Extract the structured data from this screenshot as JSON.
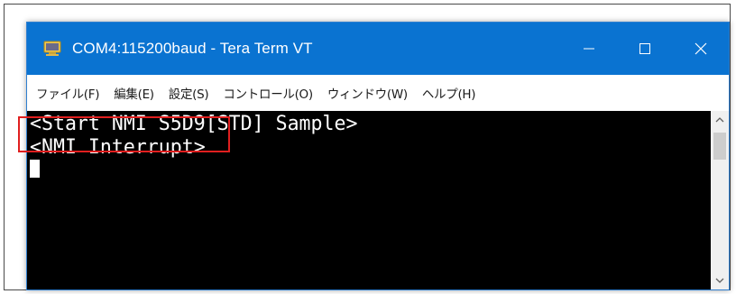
{
  "window": {
    "title": "COM4:115200baud - Tera Term VT",
    "titlebar_color": "#0a73d1",
    "icons": {
      "app": "tera-term-app-icon",
      "minimize": "minimize-icon",
      "maximize": "maximize-icon",
      "close": "close-icon"
    }
  },
  "menu": {
    "items": [
      {
        "label": "ファイル(F)"
      },
      {
        "label": "編集(E)"
      },
      {
        "label": "設定(S)"
      },
      {
        "label": "コントロール(O)"
      },
      {
        "label": "ウィンドウ(W)"
      },
      {
        "label": "ヘルプ(H)"
      }
    ]
  },
  "terminal": {
    "background": "#000000",
    "foreground": "#ffffff",
    "lines": [
      "<Start NMI S5D9[STD] Sample>",
      "<NMI Interrupt>"
    ]
  },
  "annotation": {
    "highlight_color": "#e01f1f"
  },
  "scrollbar": {
    "up_icon": "scroll-up-arrow-icon",
    "down_icon": "scroll-down-arrow-icon"
  }
}
